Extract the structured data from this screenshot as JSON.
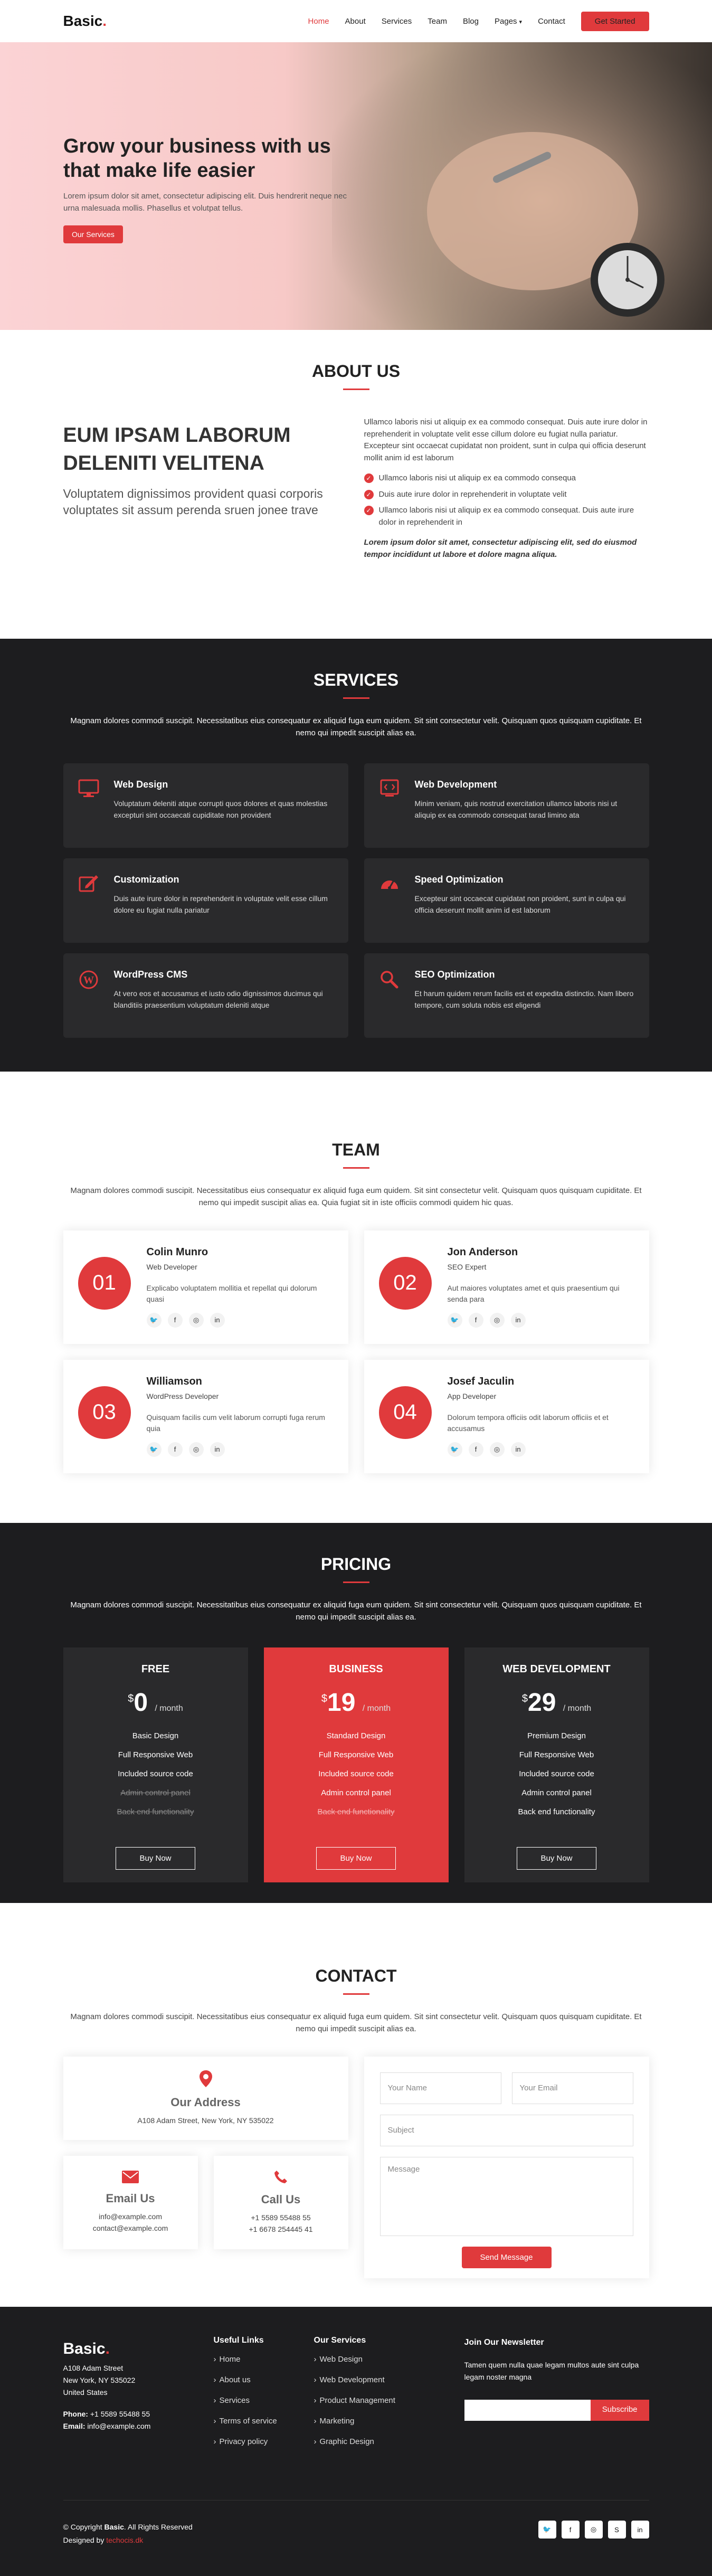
{
  "brand": {
    "logo": "Basic",
    "dot": "."
  },
  "nav": {
    "items": [
      "Home",
      "About",
      "Services",
      "Team",
      "Blog",
      "Pages"
    ],
    "contact": "Contact",
    "cta": "Get Started"
  },
  "hero": {
    "title": "Grow your business with us that make life easier",
    "text": "Lorem ipsum dolor sit amet, consectetur adipiscing elit. Duis hendrerit neque nec urna malesuada mollis. Phasellus et volutpat tellus.",
    "button": "Our Services"
  },
  "about": {
    "title": "ABOUT US",
    "heading": "EUM IPSAM LABORUM DELENITI VELITENA",
    "subheading": "Voluptatem dignissimos provident quasi corporis voluptates sit assum perenda sruen jonee trave",
    "intro": "Ullamco laboris nisi ut aliquip ex ea commodo consequat. Duis aute irure dolor in reprehenderit in voluptate velit esse cillum dolore eu fugiat nulla pariatur. Excepteur sint occaecat cupidatat non proident, sunt in culpa qui officia deserunt mollit anim id est laborum",
    "list": [
      "Ullamco laboris nisi ut aliquip ex ea commodo consequa",
      "Duis aute irure dolor in reprehenderit in voluptate velit",
      "Ullamco laboris nisi ut aliquip ex ea commodo consequat. Duis aute irure dolor in reprehenderit in"
    ],
    "closing": "Lorem ipsum dolor sit amet, consectetur adipiscing elit, sed do eiusmod tempor incididunt ut labore et dolore magna aliqua."
  },
  "services": {
    "title": "SERVICES",
    "desc": "Magnam dolores commodi suscipit. Necessitatibus eius consequatur ex aliquid fuga eum quidem. Sit sint consectetur velit. Quisquam quos quisquam cupiditate. Et nemo qui impedit suscipit alias ea.",
    "items": [
      {
        "icon": "monitor-icon",
        "title": "Web Design",
        "text": "Voluptatum deleniti atque corrupti quos dolores et quas molestias excepturi sint occaecati cupiditate non provident"
      },
      {
        "icon": "code-icon",
        "title": "Web Development",
        "text": "Minim veniam, quis nostrud exercitation ullamco laboris nisi ut aliquip ex ea commodo consequat tarad limino ata"
      },
      {
        "icon": "edit-icon",
        "title": "Customization",
        "text": "Duis aute irure dolor in reprehenderit in voluptate velit esse cillum dolore eu fugiat nulla pariatur"
      },
      {
        "icon": "speedometer-icon",
        "title": "Speed Optimization",
        "text": "Excepteur sint occaecat cupidatat non proident, sunt in culpa qui officia deserunt mollit anim id est laborum"
      },
      {
        "icon": "wordpress-icon",
        "title": "WordPress CMS",
        "text": "At vero eos et accusamus et iusto odio dignissimos ducimus qui blanditiis praesentium voluptatum deleniti atque"
      },
      {
        "icon": "search-icon",
        "title": "SEO Optimization",
        "text": "Et harum quidem rerum facilis est et expedita distinctio. Nam libero tempore, cum soluta nobis est eligendi"
      }
    ]
  },
  "team": {
    "title": "TEAM",
    "desc": "Magnam dolores commodi suscipit. Necessitatibus eius consequatur ex aliquid fuga eum quidem. Sit sint consectetur velit. Quisquam quos quisquam cupiditate. Et nemo qui impedit suscipit alias ea. Quia fugiat sit in iste officiis commodi quidem hic quas.",
    "members": [
      {
        "num": "01",
        "name": "Colin Munro",
        "role": "Web Developer",
        "quote": "Explicabo voluptatem mollitia et repellat qui dolorum quasi"
      },
      {
        "num": "02",
        "name": "Jon Anderson",
        "role": "SEO Expert",
        "quote": "Aut maiores voluptates amet et quis praesentium qui senda para"
      },
      {
        "num": "03",
        "name": "Williamson",
        "role": "WordPress Developer",
        "quote": "Quisquam facilis cum velit laborum corrupti fuga rerum quia"
      },
      {
        "num": "04",
        "name": "Josef Jaculin",
        "role": "App Developer",
        "quote": "Dolorum tempora officiis odit laborum officiis et et accusamus"
      }
    ]
  },
  "pricing": {
    "title": "PRICING",
    "desc": "Magnam dolores commodi suscipit. Necessitatibus eius consequatur ex aliquid fuga eum quidem. Sit sint consectetur velit. Quisquam quos quisquam cupiditate. Et nemo qui impedit suscipit alias ea.",
    "currency": "$",
    "period": "/ month",
    "button": "Buy Now",
    "plans": [
      {
        "name": "FREE",
        "price": "0",
        "features": [
          "Basic Design",
          "Full Responsive Web",
          "Included source code"
        ],
        "na": [
          "Admin control panel",
          "Back end functionality"
        ]
      },
      {
        "name": "BUSINESS",
        "price": "19",
        "features": [
          "Standard Design",
          "Full Responsive Web",
          "Included source code",
          "Admin control panel"
        ],
        "na": [
          "Back end functionality"
        ]
      },
      {
        "name": "WEB DEVELOPMENT",
        "price": "29",
        "features": [
          "Premium Design",
          "Full Responsive Web",
          "Included source code",
          "Admin control panel",
          "Back end functionality"
        ],
        "na": []
      }
    ]
  },
  "contact": {
    "title": "CONTACT",
    "desc": "Magnam dolores commodi suscipit. Necessitatibus eius consequatur ex aliquid fuga eum quidem. Sit sint consectetur velit. Quisquam quos quisquam cupiditate. Et nemo qui impedit suscipit alias ea.",
    "address_title": "Our Address",
    "address": "A108 Adam Street, New York, NY 535022",
    "email_title": "Email Us",
    "email1": "info@example.com",
    "email2": "contact@example.com",
    "call_title": "Call Us",
    "phone1": "+1 5589 55488 55",
    "phone2": "+1 6678 254445 41",
    "name_ph": "Your Name",
    "email_ph": "Your Email",
    "subject_ph": "Subject",
    "message_ph": "Message",
    "send": "Send Message"
  },
  "footer": {
    "address1": "A108 Adam Street",
    "address2": "New York, NY 535022",
    "address3": "United States",
    "phone_label": "Phone:",
    "phone": "+1 5589 55488 55",
    "email_label": "Email:",
    "email": "info@example.com",
    "links_title": "Useful Links",
    "links": [
      "Home",
      "About us",
      "Services",
      "Terms of service",
      "Privacy policy"
    ],
    "services_title": "Our Services",
    "services": [
      "Web Design",
      "Web Development",
      "Product Management",
      "Marketing",
      "Graphic Design"
    ],
    "news_title": "Join Our Newsletter",
    "news_text": "Tamen quem nulla quae legam multos aute sint culpa legam noster magna",
    "subscribe": "Subscribe",
    "copy_prefix": "© Copyright",
    "copy_brand": "Basic",
    "copy_suffix": ". All Rights Reserved",
    "designed_prefix": "Designed by",
    "designed_by": "techocis.dk"
  },
  "colors": {
    "accent": "#e03a3c",
    "dark": "#1d1d1f",
    "card_dark": "#2a2a2c"
  }
}
